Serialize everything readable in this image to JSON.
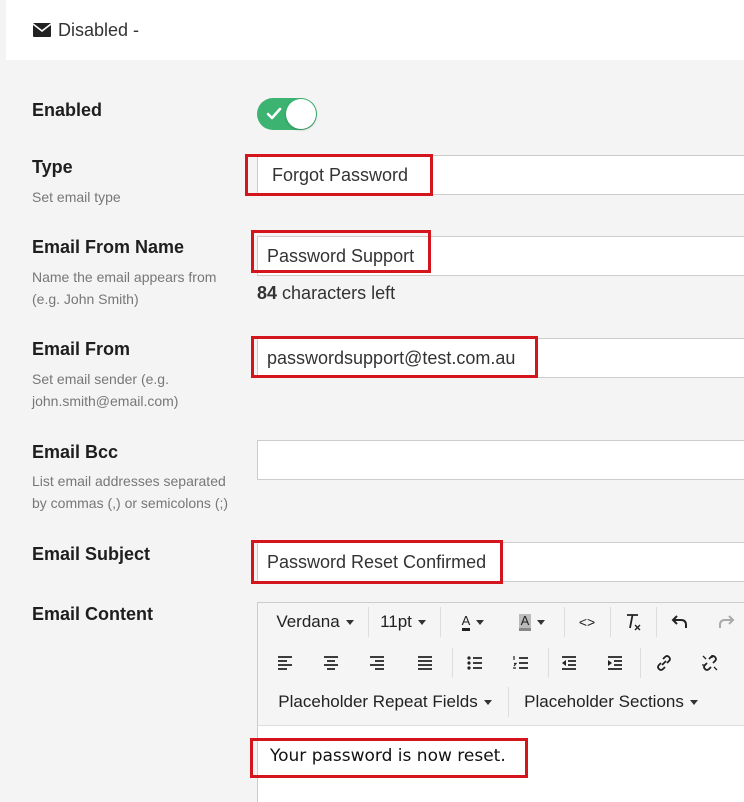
{
  "header": {
    "title": "Disabled -",
    "icon": "envelope-icon"
  },
  "fields": {
    "enabled": {
      "label": "Enabled",
      "value": true
    },
    "type": {
      "label": "Type",
      "help": "Set email type",
      "value": "Forgot Password"
    },
    "from_name": {
      "label": "Email From Name",
      "help_line1": "Name the email appears from",
      "help_line2": "(e.g. John Smith)",
      "value": "Password Support",
      "chars_left_num": "84",
      "chars_left_text": "characters left"
    },
    "email_from": {
      "label": "Email From",
      "help_line1": "Set email sender (e.g.",
      "help_line2": "john.smith@email.com)",
      "value": "passwordsupport@test.com.au"
    },
    "email_bcc": {
      "label": "Email Bcc",
      "help_line1": "List email addresses separated",
      "help_line2": "by commas (,) or semicolons (;)",
      "value": ""
    },
    "subject": {
      "label": "Email Subject",
      "value": "Password Reset Confirmed"
    },
    "content": {
      "label": "Email Content",
      "body": "Your password is now reset."
    }
  },
  "toolbar": {
    "font": "Verdana",
    "size": "11pt",
    "text_color_glyph": "A",
    "highlight_glyph": "A",
    "code_glyph": "<>",
    "placeholder_repeat": "Placeholder Repeat Fields",
    "placeholder_sections": "Placeholder Sections"
  },
  "colors": {
    "toggle_on": "#3cb371",
    "highlight_border": "#d4151d"
  }
}
